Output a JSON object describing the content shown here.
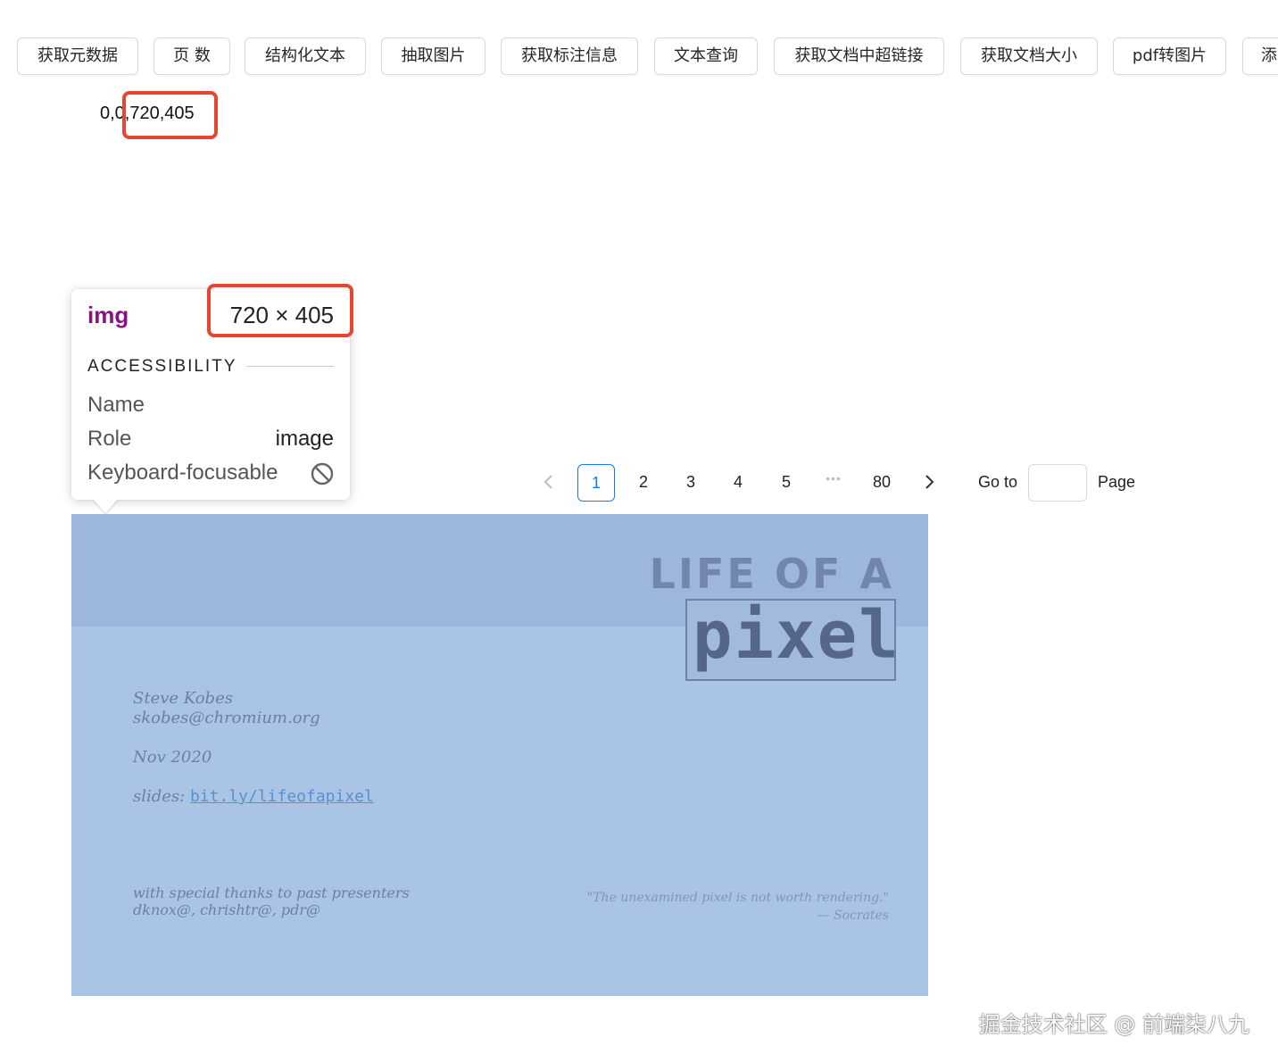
{
  "toolbar": {
    "buttons": [
      "获取元数据",
      "页 数",
      "结构化文本",
      "抽取图片",
      "获取标注信息",
      "文本查询",
      "获取文档中超链接",
      "获取文档大小",
      "pdf转图片",
      "添"
    ]
  },
  "coords_text": "0,0,720,405",
  "tooltip": {
    "tag": "img",
    "dimensions": "720 × 405",
    "section": "ACCESSIBILITY",
    "rows": {
      "name_label": "Name",
      "role_label": "Role",
      "role_value": "image",
      "focus_label": "Keyboard-focusable"
    }
  },
  "pagination": {
    "pages": [
      "1",
      "2",
      "3",
      "4",
      "5"
    ],
    "ellipsis": "•••",
    "last": "80",
    "current": "1",
    "goto_label": "Go to",
    "page_label": "Page",
    "prev_icon": "chevron-left-icon",
    "next_icon": "chevron-right-icon"
  },
  "slide": {
    "heading": "LIFE OF A",
    "heading_word": "pixel",
    "author": "Steve Kobes",
    "email": "skobes@chromium.org",
    "date": "Nov 2020",
    "slides_label": "slides:",
    "slides_link": "bit.ly/lifeofapixel",
    "thanks": "with special thanks to past presenters",
    "thanks_names": "dknox@, chrishtr@, pdr@",
    "quote": "\"The unexamined pixel is not worth rendering.\"",
    "quote_author": "— Socrates"
  },
  "watermark": "掘金技术社区 @ 前端柒八九",
  "colors": {
    "accent": "#1677ff",
    "highlight": "#e5462f",
    "tag": "#881280",
    "overlay": "#a9c4e4"
  }
}
